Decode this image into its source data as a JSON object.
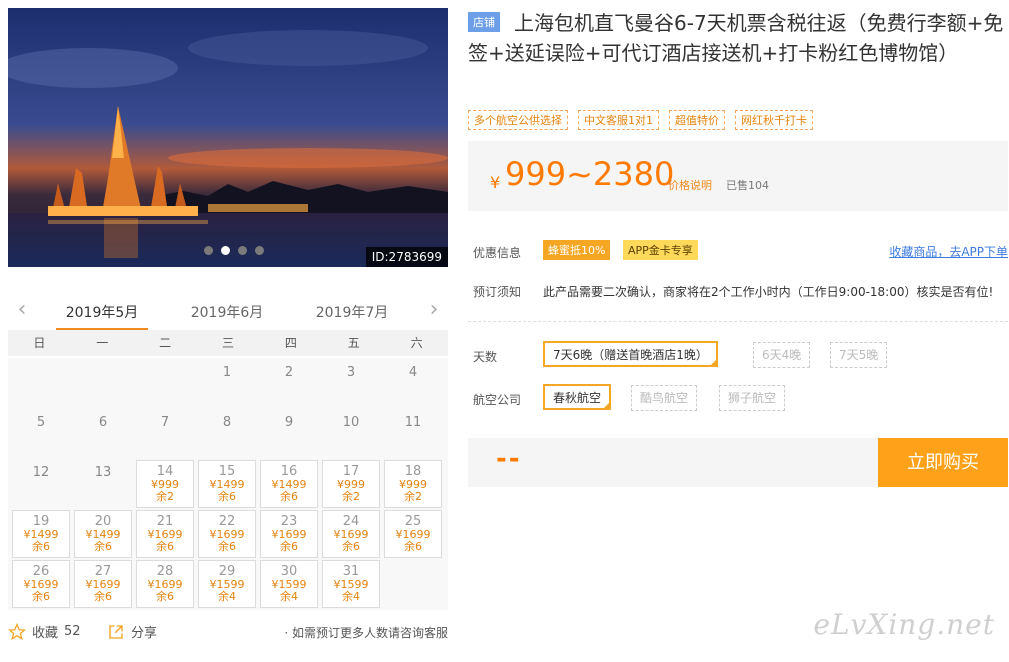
{
  "hero": {
    "id_label": "ID:2783699",
    "slide_count": 4,
    "active_slide": 1
  },
  "calendar": {
    "months": [
      "2019年5月",
      "2019年6月",
      "2019年7月"
    ],
    "active_month": 0,
    "weekdays": [
      "日",
      "一",
      "二",
      "三",
      "四",
      "五",
      "六"
    ],
    "first_weekday": 3,
    "days_in_month": 31,
    "prices": {
      "14": {
        "price": "¥999",
        "stock": "余2"
      },
      "15": {
        "price": "¥1499",
        "stock": "余6"
      },
      "16": {
        "price": "¥1499",
        "stock": "余6"
      },
      "17": {
        "price": "¥999",
        "stock": "余2"
      },
      "18": {
        "price": "¥999",
        "stock": "余2"
      },
      "19": {
        "price": "¥1499",
        "stock": "余6"
      },
      "20": {
        "price": "¥1499",
        "stock": "余6"
      },
      "21": {
        "price": "¥1699",
        "stock": "余6"
      },
      "22": {
        "price": "¥1699",
        "stock": "余6"
      },
      "23": {
        "price": "¥1699",
        "stock": "余6"
      },
      "24": {
        "price": "¥1699",
        "stock": "余6"
      },
      "25": {
        "price": "¥1699",
        "stock": "余6"
      },
      "26": {
        "price": "¥1699",
        "stock": "余6"
      },
      "27": {
        "price": "¥1699",
        "stock": "余6"
      },
      "28": {
        "price": "¥1699",
        "stock": "余6"
      },
      "29": {
        "price": "¥1599",
        "stock": "余4"
      },
      "30": {
        "price": "¥1599",
        "stock": "余4"
      },
      "31": {
        "price": "¥1599",
        "stock": "余4"
      }
    }
  },
  "footer": {
    "favorite_label": "收藏",
    "favorite_count": "52",
    "share_label": "分享",
    "group_note": "· 如需预订更多人数请咨询客服"
  },
  "product": {
    "shop_badge": "店铺",
    "title": "上海包机直飞曼谷6-7天机票含税往返（免费行李额+免签+送延误险+可代订酒店接送机+打卡粉红色博物馆）",
    "tags": [
      "多个航空公供选择",
      "中文客服1对1",
      "超值特价",
      "网红秋千打卡"
    ],
    "price_symbol": "¥",
    "price": "999~2380",
    "price_note": "价格说明",
    "sold": "已售104",
    "promo_label": "优惠信息",
    "promos": [
      "蜂蜜抵10%",
      "APP金卡专享"
    ],
    "fav_link": "收藏商品，去APP下单",
    "notice_label": "预订须知",
    "notice": "此产品需要二次确认，商家将在2个工作小时内（工作日9:00-18:00）核实是否有位!",
    "days_label": "天数",
    "day_options": [
      "7天6晚（赠送首晚酒店1晚）",
      "6天4晚",
      "7天5晚"
    ],
    "airline_label": "航空公司",
    "airline_options": [
      "春秋航空",
      "酷鸟航空",
      "狮子航空"
    ],
    "total_placeholder": "--",
    "buy_label": "立即购买"
  },
  "watermark": "eLvXing.net",
  "colors": {
    "accent": "#ff7a00",
    "button": "#ffa21a",
    "tag_border": "#f3a45c",
    "link": "#3d7be0",
    "badge": "#6d9ee8"
  }
}
